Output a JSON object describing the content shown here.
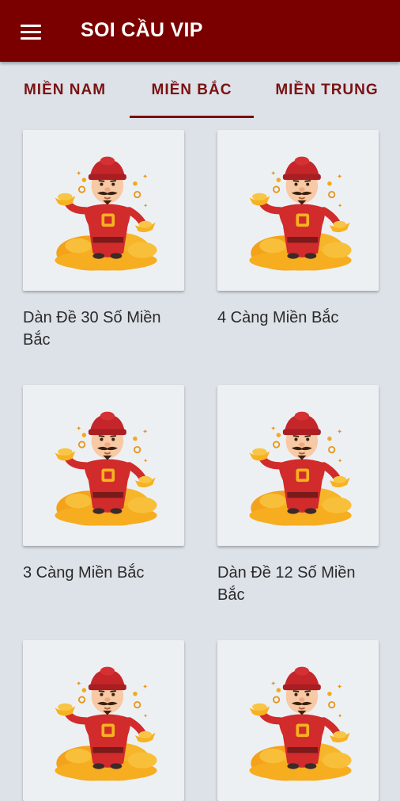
{
  "app": {
    "title": "SOI CẦU VIP",
    "menu_icon": "hamburger-menu-icon"
  },
  "tabs": [
    {
      "label": "MIỀN NAM",
      "selected": false
    },
    {
      "label": "MIỀN BẮC",
      "selected": true
    },
    {
      "label": "MIỀN TRUNG",
      "selected": false
    }
  ],
  "cards": [
    {
      "label": "Dàn Đề 30 Số Miền Bắc",
      "image": "god-of-wealth-illustration"
    },
    {
      "label": "4 Càng Miền Bắc",
      "image": "god-of-wealth-illustration"
    },
    {
      "label": "3 Càng Miền Bắc",
      "image": "god-of-wealth-illustration"
    },
    {
      "label": "Dàn Đề 12 Số Miền Bắc",
      "image": "god-of-wealth-illustration"
    },
    {
      "label": "",
      "image": "god-of-wealth-illustration"
    },
    {
      "label": "",
      "image": "god-of-wealth-illustration"
    }
  ],
  "colors": {
    "app_bar": "#7a0000",
    "tab_text": "#7a1212",
    "background": "#dde2e8",
    "card_background": "#edf0f3"
  }
}
